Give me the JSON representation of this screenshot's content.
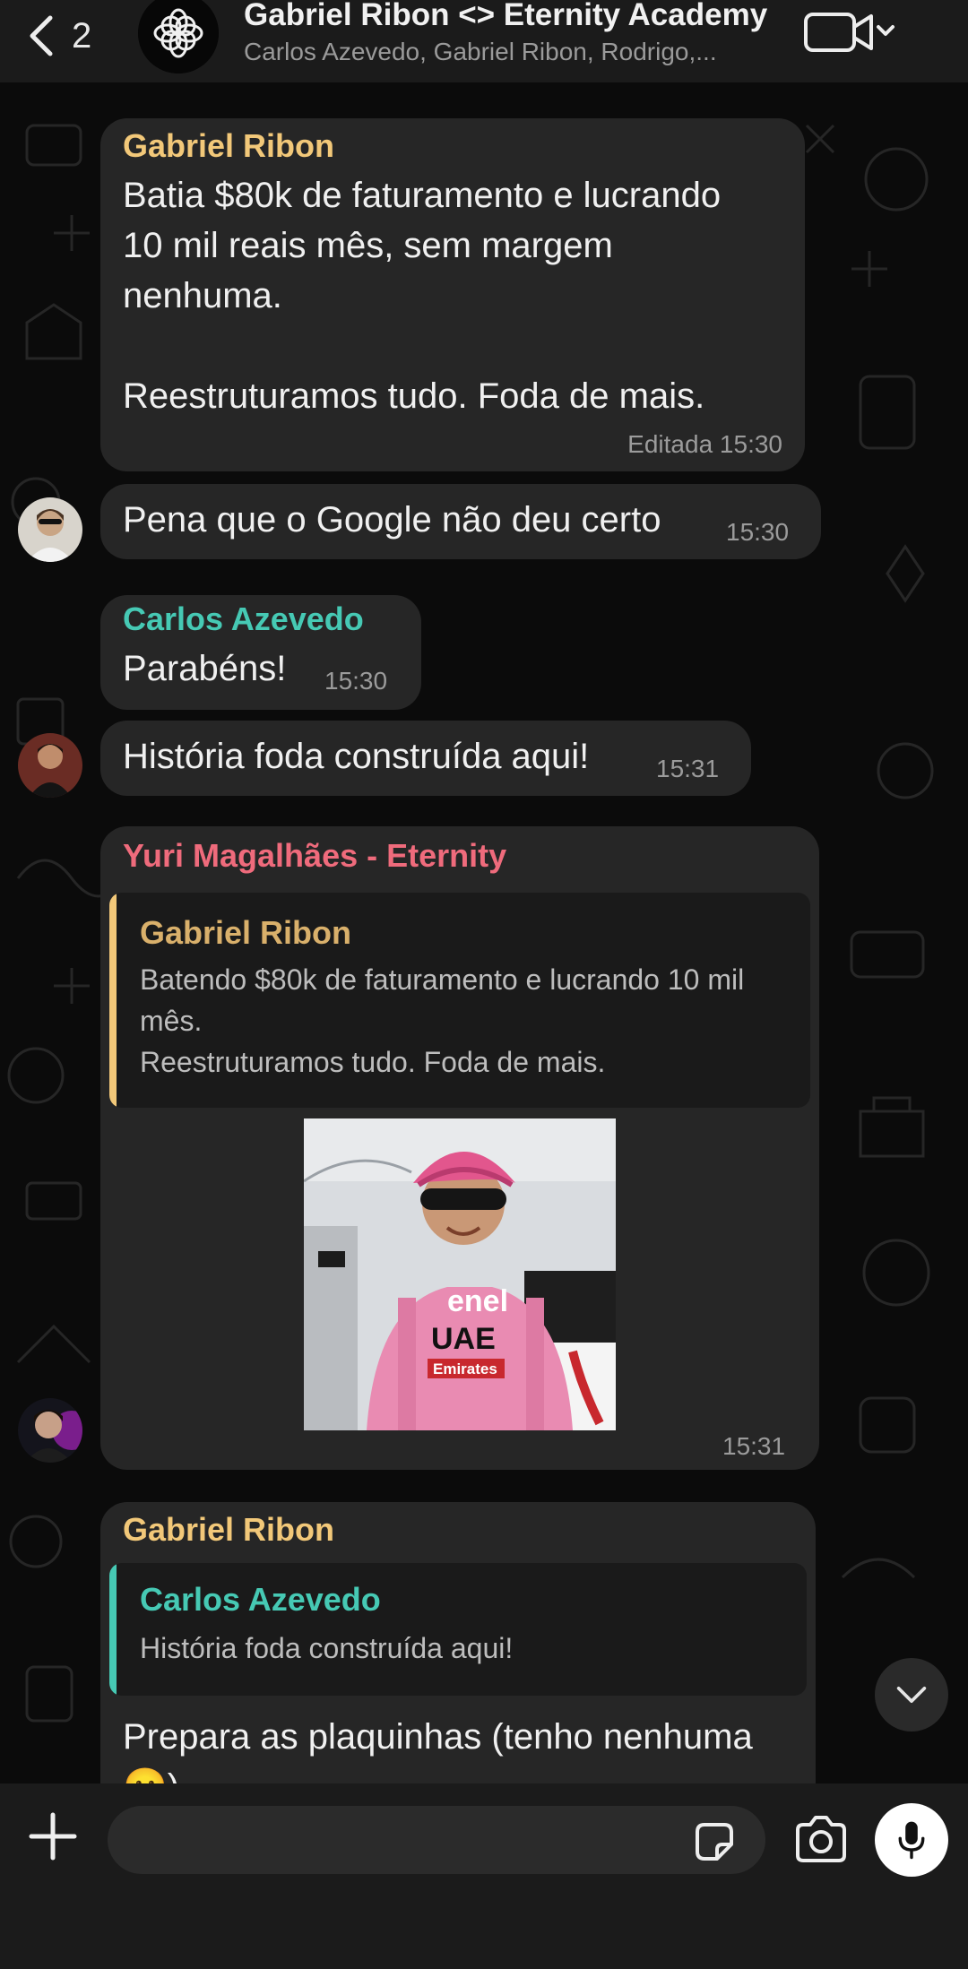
{
  "header": {
    "back_count": "2",
    "title": "Gabriel Ribon <> Eternity Academy",
    "members": "Carlos Azevedo, Gabriel Ribon, Rodrigo,...",
    "icons": [
      "chevron-left-icon",
      "video-call-icon",
      "chevron-down-icon"
    ]
  },
  "colors": {
    "gabriel": "#f2c879",
    "carlos": "#46c9b4",
    "yuri": "#ef6b7c",
    "bubble": "#262626",
    "background": "#0b0b0b"
  },
  "messages": [
    {
      "sender": "Gabriel Ribon",
      "text": "Batia $80k de faturamento e lucrando\n10 mil reais mês, sem margem\nnenhuma.\n\nReestruturamos tudo. Foda de mais.",
      "edited_label": "Editada",
      "time": "15:30"
    },
    {
      "text": "Pena que o Google não deu certo",
      "time": "15:30"
    },
    {
      "sender": "Carlos Azevedo",
      "text": "Parabéns!",
      "time": "15:30"
    },
    {
      "text": "História foda construída aqui!",
      "time": "15:31"
    },
    {
      "sender": "Yuri Magalhães - Eternity",
      "quote": {
        "sender": "Gabriel Ribon",
        "text": "Batendo $80k de faturamento e lucrando 10 mil\nmês.\nReestruturamos tudo. Foda de mais."
      },
      "image_shown": "cyclist in pink jersey and helmet",
      "image_jersey_text": [
        "enel",
        "UAE",
        "Emirates"
      ],
      "time": "15:31"
    },
    {
      "sender": "Gabriel Ribon",
      "quote": {
        "sender": "Carlos Azevedo",
        "text": "História foda construída aqui!"
      },
      "text": "Prepara as plaquinhas (tenho nenhuma\n😶)"
    }
  ],
  "composer": {
    "icons": [
      "plus-icon",
      "sticker-icon",
      "camera-icon",
      "microphone-icon"
    ]
  },
  "scroll_down_icon": "chevron-down-icon"
}
